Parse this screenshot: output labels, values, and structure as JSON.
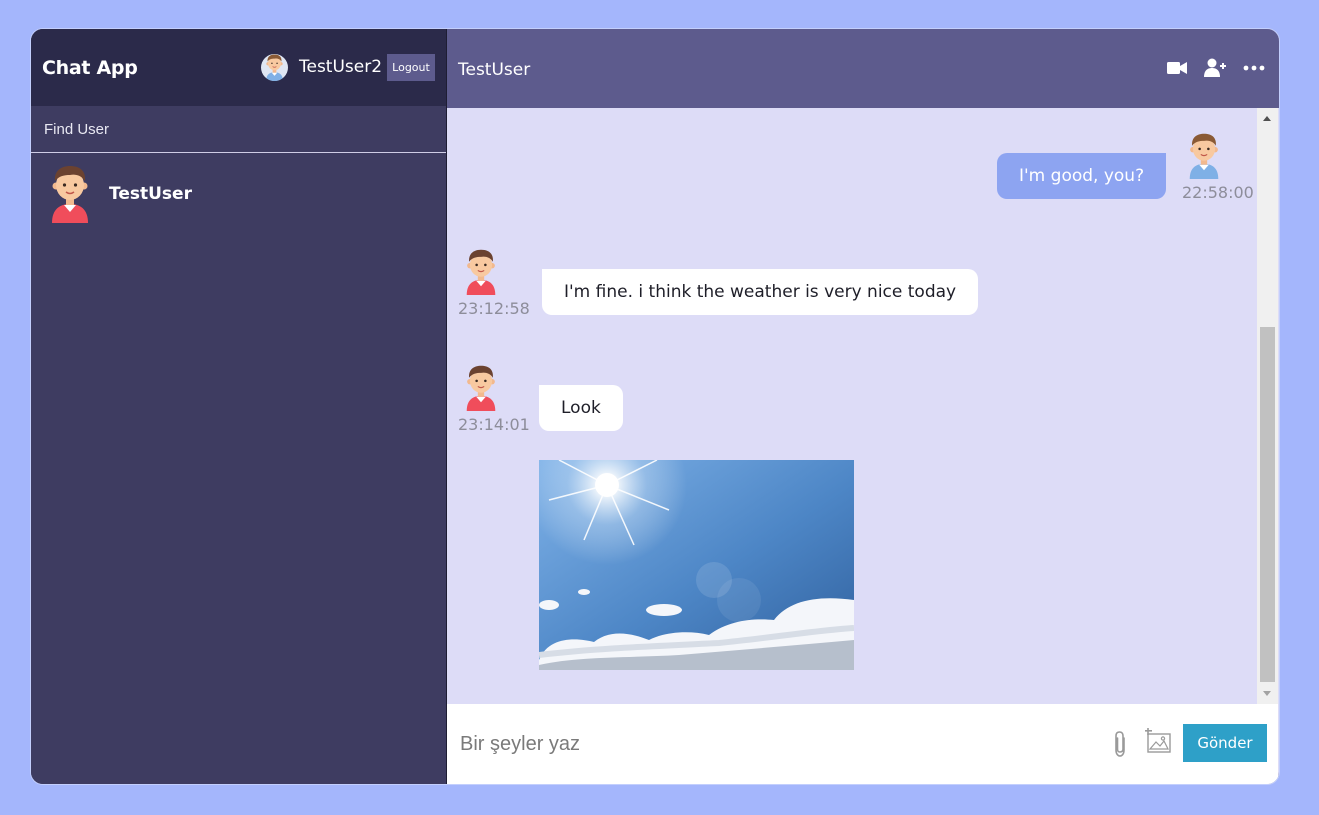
{
  "sidebar": {
    "brand": "Chat App",
    "current_user": {
      "name": "TestUser2",
      "avatar": "boy-avatar-icon"
    },
    "logout_label": "Logout",
    "search": {
      "placeholder": "Find User",
      "value": ""
    },
    "users": [
      {
        "name": "TestUser",
        "avatar": "boy-red-shirt-avatar-icon"
      }
    ]
  },
  "chat": {
    "title": "TestUser",
    "header_icons": [
      "video-camera-icon",
      "add-user-icon",
      "more-icon"
    ],
    "messages": [
      {
        "sender": "me",
        "text": "I'm good, you?",
        "time": "22:58:00"
      },
      {
        "sender": "TestUser",
        "text": "I'm fine. i think the weather is very nice today",
        "time": "23:12:58"
      },
      {
        "sender": "TestUser",
        "text": "Look",
        "time": "23:14:01"
      },
      {
        "sender": "TestUser",
        "image": "sunny-sky-photo"
      }
    ],
    "composer": {
      "placeholder": "Bir şeyler yaz",
      "value": "",
      "send_label": "Gönder"
    }
  },
  "colors": {
    "page_background": "#a4b6fc",
    "sidebar": "#3e3c61",
    "sidebar_header": "#2b2a4a",
    "chat_header": "#5d5b8d",
    "chat_background": "#dddcf7",
    "my_bubble": "#8da4f1",
    "send_button": "#2ea0c8"
  }
}
